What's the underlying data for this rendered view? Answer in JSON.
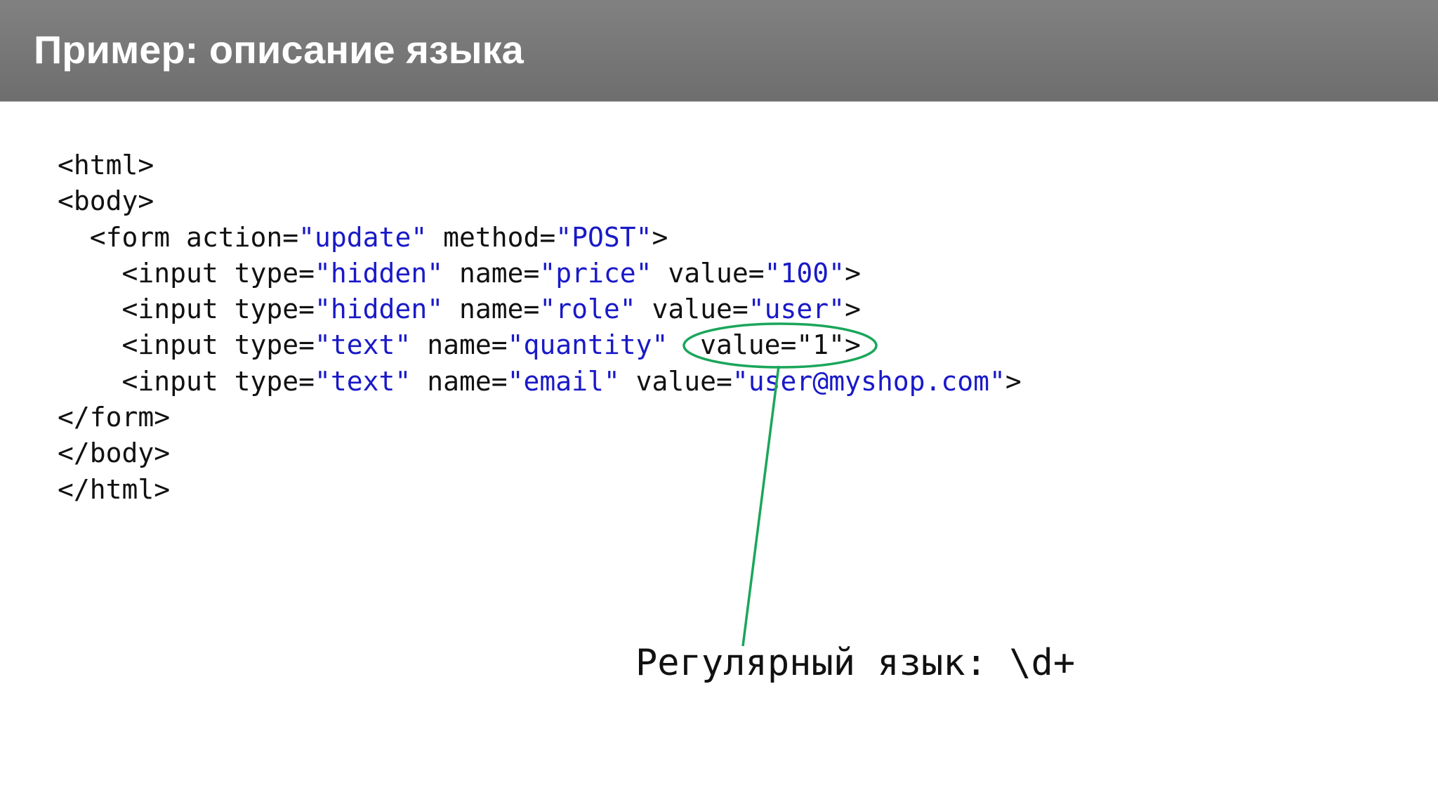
{
  "header": {
    "title": "Пример: описание языка"
  },
  "code": {
    "lines": [
      [
        {
          "t": "<html>",
          "s": false
        }
      ],
      [
        {
          "t": "<body>",
          "s": false
        }
      ],
      [
        {
          "t": "  <form action=",
          "s": false
        },
        {
          "t": "\"update\"",
          "s": true
        },
        {
          "t": " method=",
          "s": false
        },
        {
          "t": "\"POST\"",
          "s": true
        },
        {
          "t": ">",
          "s": false
        }
      ],
      [
        {
          "t": "    <input type=",
          "s": false
        },
        {
          "t": "\"hidden\"",
          "s": true
        },
        {
          "t": " name=",
          "s": false
        },
        {
          "t": "\"price\"",
          "s": true
        },
        {
          "t": " value=",
          "s": false
        },
        {
          "t": "\"100\"",
          "s": true
        },
        {
          "t": ">",
          "s": false
        }
      ],
      [
        {
          "t": "    <input type=",
          "s": false
        },
        {
          "t": "\"hidden\"",
          "s": true
        },
        {
          "t": " name=",
          "s": false
        },
        {
          "t": "\"role\"",
          "s": true
        },
        {
          "t": " value=",
          "s": false
        },
        {
          "t": "\"user\"",
          "s": true
        },
        {
          "t": ">",
          "s": false
        }
      ],
      [
        {
          "t": "    <input type=",
          "s": false
        },
        {
          "t": "\"text\"",
          "s": true
        },
        {
          "t": " name=",
          "s": false
        },
        {
          "t": "\"quantity\"",
          "s": true
        },
        {
          "t": "  value=\"1\">",
          "s": false
        }
      ],
      [
        {
          "t": "    <input type=",
          "s": false
        },
        {
          "t": "\"text\"",
          "s": true
        },
        {
          "t": " name=",
          "s": false
        },
        {
          "t": "\"email\"",
          "s": true
        },
        {
          "t": " value=",
          "s": false
        },
        {
          "t": "\"user@myshop.com\"",
          "s": true
        },
        {
          "t": ">",
          "s": false
        }
      ],
      [
        {
          "t": "</form>",
          "s": false
        }
      ],
      [
        {
          "t": "</body>",
          "s": false
        }
      ],
      [
        {
          "t": "</html>",
          "s": false
        }
      ]
    ]
  },
  "annotation": {
    "caption": "Регулярный язык: \\d+",
    "highlight_color": "#1aa65a"
  },
  "colors": {
    "string": "#1919c8",
    "plain": "#111111",
    "header_bg": "#777777"
  }
}
